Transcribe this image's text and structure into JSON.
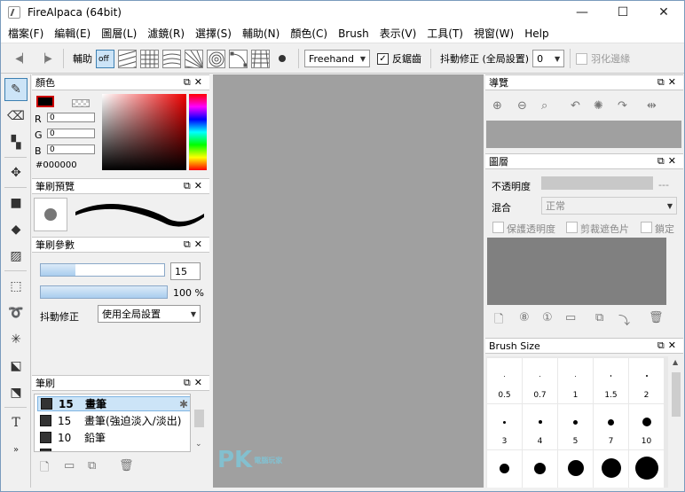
{
  "window": {
    "title": "FireAlpaca (64bit)"
  },
  "menu": [
    "檔案(F)",
    "編輯(E)",
    "圖層(L)",
    "濾鏡(R)",
    "選擇(S)",
    "輔助(N)",
    "顏色(C)",
    "Brush",
    "表示(V)",
    "工具(T)",
    "視窗(W)",
    "Help"
  ],
  "toolbar": {
    "assist_label": "輔助",
    "off_label": "off",
    "mode": "Freehand",
    "antialias_label": "反鋸齒",
    "stabilizer_label": "抖動修正 (全局設置)",
    "stabilizer_value": "0",
    "feather_label": "羽化邊緣"
  },
  "color_panel": {
    "title": "顏色",
    "r_label": "R",
    "g_label": "G",
    "b_label": "B",
    "r": "0",
    "g": "0",
    "b": "0",
    "hex": "#000000"
  },
  "brush_preview": {
    "title": "筆刷預覽"
  },
  "brush_params": {
    "title": "筆刷參數",
    "size": "15",
    "opacity": "100 %",
    "opacity_fraction": 1.0,
    "size_fraction": 0.28,
    "stabilizer_label": "抖動修正",
    "stabilizer_value": "使用全局設置"
  },
  "brush_list": {
    "title": "筆刷",
    "items": [
      {
        "size": "15",
        "name": "畫筆"
      },
      {
        "size": "15",
        "name": "畫筆(強迫淡入/淡出)"
      },
      {
        "size": "10",
        "name": "鉛筆"
      },
      {
        "size": "",
        "name": ""
      }
    ]
  },
  "navigator": {
    "title": "導覽"
  },
  "layers": {
    "title": "圖層",
    "opacity_label": "不透明度",
    "opacity_value": "---",
    "blend_label": "混合",
    "blend_value": "正常",
    "protect_label": "保護透明度",
    "clip_label": "剪裁遮色片",
    "lock_label": "鎖定"
  },
  "brush_size": {
    "title": "Brush Size",
    "sizes": [
      "0.5",
      "0.7",
      "1",
      "1.5",
      "2",
      "3",
      "4",
      "5",
      "7",
      "10",
      "",
      "",
      "",
      "",
      ""
    ]
  },
  "watermark": {
    "text": "PK",
    "sub": "電腦玩家"
  }
}
